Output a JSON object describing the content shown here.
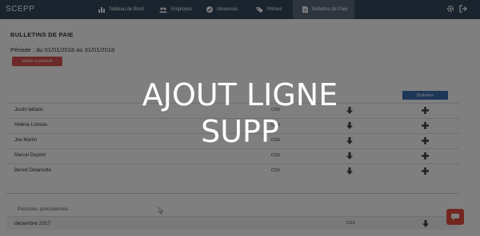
{
  "nav": {
    "brand": "SCEPP",
    "items": [
      {
        "label": "Tableau de Bord",
        "icon": "bar-chart-icon"
      },
      {
        "label": "Employés",
        "icon": "users-icon"
      },
      {
        "label": "Absences",
        "icon": "check-circle-icon"
      },
      {
        "label": "Primes",
        "icon": "tag-icon"
      },
      {
        "label": "Bulletins de Paie",
        "icon": "document-icon",
        "active": true
      }
    ],
    "right_icons": [
      "settings-gear-icon",
      "logout-icon"
    ]
  },
  "page": {
    "title": "BULLETINS DE PAIE",
    "period": "Période : du 01/01/2018 au 31/01/2018",
    "validate_label": "Valider la période",
    "bulletins_header": "Bulletins"
  },
  "employees": [
    {
      "name": "Justin leblanc",
      "file": "CSV"
    },
    {
      "name": "Hélène Lotredu",
      "file": "CSV"
    },
    {
      "name": "Joe Martin",
      "file": "CSV"
    },
    {
      "name": "Marcel Dupont",
      "file": "CSV"
    },
    {
      "name": "Benoit Delamotte",
      "file": "CSV"
    }
  ],
  "previous": {
    "label": "Périodes précédentes",
    "rows": [
      {
        "name": "décembre 2017",
        "file": "CSV"
      }
    ]
  },
  "overlay": {
    "line1": "AJOUT LIGNE",
    "line2": "SUPP"
  },
  "colors": {
    "nav_bg": "#34495e",
    "nav_active": "#5a6b7d",
    "danger": "#d9534f",
    "primary": "#3a6fb0",
    "chat": "#e74c3c"
  }
}
